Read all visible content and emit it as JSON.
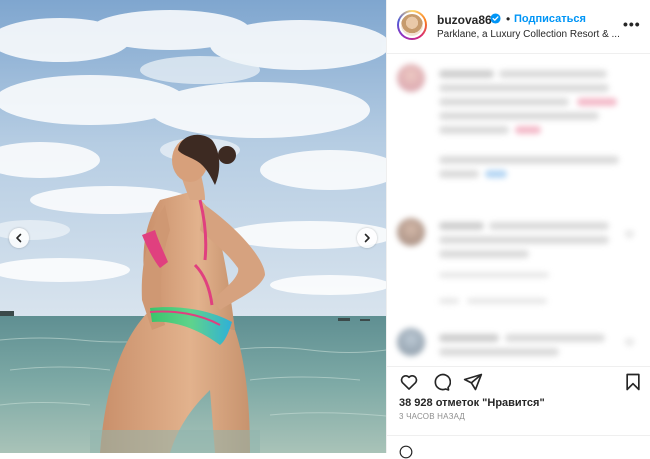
{
  "post": {
    "username": "buzova86",
    "follow_label": "Подписаться",
    "separator": "•",
    "location": "Parklane, a Luxury Collection Resort & ...",
    "more_label": "•••",
    "likes_text": "38 928 отметок \"Нравится\"",
    "time_text": "3 ЧАСОВ НАЗАД"
  },
  "colors": {
    "accent": "#0095f6",
    "sky": "#9fbfe0",
    "sea": "#5b8e91"
  },
  "icons": {
    "verified": "verified-badge-icon",
    "prev": "chevron-left-icon",
    "next": "chevron-right-icon",
    "like": "heart-icon",
    "comment": "comment-icon",
    "share": "send-icon",
    "save": "bookmark-icon",
    "emoji": "emoji-icon",
    "more": "more-options-icon"
  }
}
